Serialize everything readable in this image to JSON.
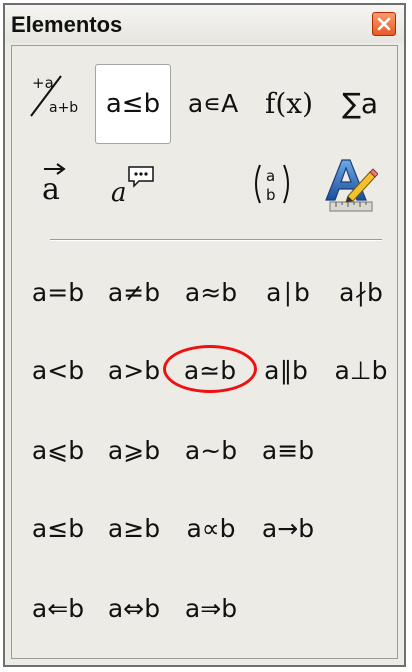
{
  "window": {
    "title": "Elementos",
    "close_icon": "close-icon"
  },
  "categories": [
    {
      "label": "+a / a+b",
      "icon": "unary-binary-operators-icon"
    },
    {
      "label": "a≤b",
      "icon": "relations-icon",
      "selected": true
    },
    {
      "label": "a∊A",
      "icon": "set-operations-icon"
    },
    {
      "label": "f(x)",
      "icon": "functions-icon"
    },
    {
      "label": "∑a",
      "icon": "operators-icon"
    },
    {
      "label": "a⃗",
      "icon": "attributes-icon"
    },
    {
      "label": "a",
      "icon": "others-icon"
    },
    {
      "label": "(a/b)",
      "icon": "brackets-icon"
    },
    {
      "label": "A",
      "icon": "formats-icon"
    }
  ],
  "relations": [
    "a=b",
    "a≠b",
    "a≈b",
    "a∣b",
    "a∤b",
    "a<b",
    "a>b",
    "a≃b",
    "a∥b",
    "a⊥b",
    "a⩽b",
    "a⩾b",
    "a~b",
    "a≡b",
    "a≤b",
    "a≥b",
    "a∝b",
    "a→b",
    "a⇐b",
    "a⇔b",
    "a⇒b"
  ],
  "highlight": {
    "item": "a≃b",
    "color": "#ee1111"
  }
}
